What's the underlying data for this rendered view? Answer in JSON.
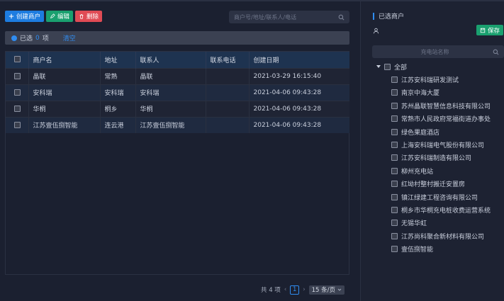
{
  "toolbar": {
    "create_label": "创建商户",
    "edit_label": "编辑",
    "delete_label": "删除"
  },
  "search": {
    "placeholder": "商户号/地址/联系人/电话"
  },
  "selection": {
    "prefix": "已选",
    "count": "0",
    "suffix": "项",
    "clear_label": "清空"
  },
  "table": {
    "columns": [
      "商户名",
      "地址",
      "联系人",
      "联系电话",
      "创建日期"
    ],
    "rows": [
      {
        "name": "晶联",
        "address": "常熟",
        "contact": "晶联",
        "phone": "",
        "created": "2021-03-29 16:15:40"
      },
      {
        "name": "安科瑞",
        "address": "安科瑞",
        "contact": "安科瑞",
        "phone": "",
        "created": "2021-04-06 09:43:28"
      },
      {
        "name": "华桐",
        "address": "桐乡",
        "contact": "华桐",
        "phone": "",
        "created": "2021-04-06 09:43:28"
      },
      {
        "name": "江苏壹伍捌智能",
        "address": "连云港",
        "contact": "江苏壹伍捌智能",
        "phone": "",
        "created": "2021-04-06 09:43:28"
      }
    ]
  },
  "pagination": {
    "total_label": "共 4 项",
    "current_page": "1",
    "page_size_label": "15 条/页"
  },
  "right_panel": {
    "title": "已选商户",
    "save_label": "保存",
    "search_placeholder": "充电站名称",
    "tree_root": "全部",
    "stations": [
      "江苏安科瑞研发测试",
      "南京中海大厦",
      "苏州晶联智慧信息科技有限公司",
      "常熟市人民政府常福街道办事处",
      "绿色果庭酒店",
      "上海安科瑞电气股份有限公司",
      "江苏安科瑞制造有限公司",
      "柳州充电站",
      "红坳村整村搬迁安置房",
      "镇江绿建工程咨询有限公司",
      "桐乡市华桐充电桩收费运营系统",
      "无锡华虹",
      "江苏尚科聚合新材料有限公司",
      "壹伍捌智能"
    ]
  },
  "colors": {
    "accent": "#2f8cf0",
    "create": "#1d7ce0",
    "edit": "#1aa06f",
    "delete": "#e04b55",
    "save": "#1aa06f"
  }
}
